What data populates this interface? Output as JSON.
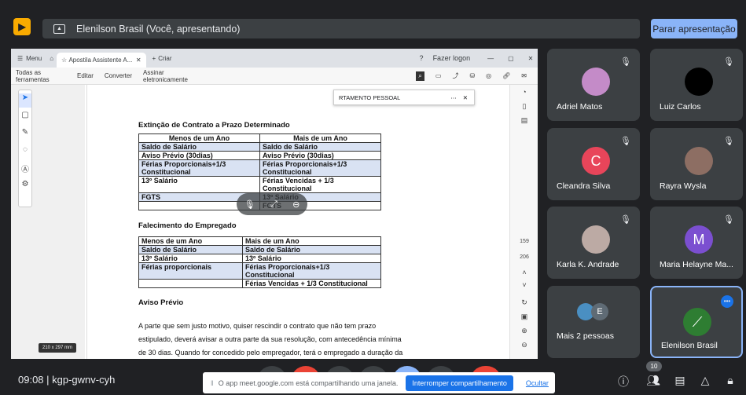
{
  "presentation": {
    "banner": "Elenilson Brasil (Você, apresentando)",
    "stop_label": "Parar apresentação"
  },
  "browser": {
    "menu": "Menu",
    "tab_title": "Apostila Assistente A...",
    "new_tab": "Criar",
    "login": "Fazer logon",
    "toolbar": [
      "Todas as ferramentas",
      "Editar",
      "Converter",
      "Assinar eletronicamente"
    ]
  },
  "document": {
    "search_text": "RTAMENTO PESSOAL",
    "section1_title": "Extinção de Contrato a Prazo Determinado",
    "table1": {
      "headers": [
        "Menos de um Ano",
        "Mais de um Ano"
      ],
      "rows": [
        [
          "Saldo de Salário",
          "Saldo de Salário"
        ],
        [
          "Aviso Prévio (30dias)",
          "Aviso Prévio (30dias)"
        ],
        [
          "Férias Proporcionais+1/3 Constitucional",
          "Férias Proporcionais+1/3 Constitucional"
        ],
        [
          "13º Salário",
          "Férias Vencidas + 1/3 Constitucional"
        ],
        [
          "FGTS",
          "13º Salário"
        ],
        [
          "",
          "FGTS"
        ]
      ]
    },
    "section2_title": "Falecimento do Empregado",
    "table2": {
      "headers": [
        "Menos de um Ano",
        "Mais de um Ano"
      ],
      "rows": [
        [
          "Saldo de Salário",
          "Saldo de Salário"
        ],
        [
          "13º Salário",
          "13º Salário"
        ],
        [
          "Férias proporcionais",
          "Férias Proporcionais+1/3 Constitucional"
        ],
        [
          "",
          "Férias Vencidas + 1/3 Constitucional"
        ]
      ]
    },
    "section3_title": "Aviso Prévio",
    "para_lines": [
      "A parte que sem justo motivo, quiser rescindir o contrato que não tem prazo",
      "estipulado, deverá avisar a outra parte da sua resolução, com antecedência mínima",
      "de 30 dias. Quando for concedido pelo empregador, terá o empregado a duração da"
    ],
    "page_size": "210 x 297 mm",
    "page_numbers": [
      "159",
      "206"
    ]
  },
  "participants": [
    {
      "name": "Adriel Matos",
      "initial": "",
      "color": "#c48bc8"
    },
    {
      "name": "Luiz Carlos",
      "initial": "",
      "color": "#000000"
    },
    {
      "name": "Cleandra Silva",
      "initial": "C",
      "color": "#e8455a"
    },
    {
      "name": "Rayra Wysla",
      "initial": "",
      "color": "#8d6e63"
    },
    {
      "name": "Karla K. Andrade",
      "initial": "",
      "color": "#bcaaa4"
    },
    {
      "name": "Maria Helayne Ma...",
      "initial": "M",
      "color": "#7b4fd0"
    },
    {
      "name": "Mais 2 pessoas",
      "initial": "E",
      "color": "#5f6b75"
    },
    {
      "name": "Elenilson Brasil",
      "initial": "",
      "color": "#2e7d32"
    }
  ],
  "bottom": {
    "time_code": "09:08 | kgp-gwnv-cyh",
    "notice": "O app meet.google.com está compartilhando uma janela.",
    "notice_stop": "Interromper compartilhamento",
    "notice_hide": "Ocultar",
    "people_count": "10"
  },
  "colors": {
    "stop_button": "#8ab4f8",
    "accent_blue": "#1a73e8",
    "tile_bg": "#3c4043"
  }
}
